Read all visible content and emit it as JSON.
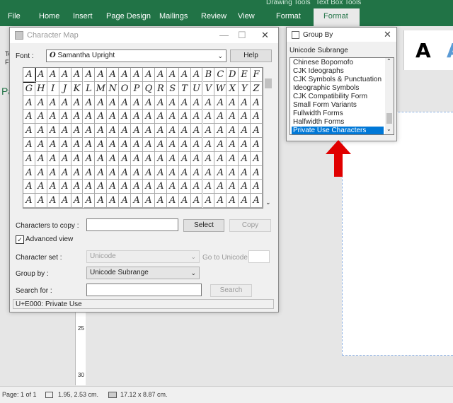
{
  "ribbon": {
    "context_tabs": [
      "Drawing Tools",
      "Text Box Tools"
    ],
    "tabs": [
      "File",
      "Home",
      "Insert",
      "Page Design",
      "Mailings",
      "Review",
      "View",
      "Format"
    ],
    "selected_tab": "Format",
    "colors": {
      "ribbon": "#217346",
      "selected": "#0078d7",
      "arrow": "#e00000"
    }
  },
  "left_fragments": {
    "te": "Te",
    "fi": "Fi",
    "pa": "Pa"
  },
  "preview_letters": {
    "a1": "A",
    "a2": "A"
  },
  "ruler": {
    "marks": [
      "25",
      "30"
    ]
  },
  "status_bar": {
    "page": "Page: 1 of 1",
    "position": "1.95, 2.53 cm.",
    "size": "17.12 x  8.87 cm."
  },
  "charmap": {
    "title": "Character Map",
    "font_label": "Font :",
    "font_value": "Samantha Upright",
    "font_icon": "O",
    "help_button": "Help",
    "grid_row1": [
      "A",
      "A",
      "A",
      "A",
      "A",
      "A",
      "A",
      "A",
      "A",
      "A",
      "A",
      "A",
      "A",
      "A",
      "A",
      "B",
      "C",
      "D",
      "E",
      "F"
    ],
    "grid_row2": [
      "G",
      "H",
      "I",
      "J",
      "K",
      "L",
      "M",
      "N",
      "O",
      "P",
      "Q",
      "R",
      "S",
      "T",
      "U",
      "V",
      "W",
      "X",
      "Y",
      "Z"
    ],
    "grid_fill": "A",
    "copy_label": "Characters to copy :",
    "select_button": "Select",
    "copy_button": "Copy",
    "advanced_view": "Advanced view",
    "charset_label": "Character set :",
    "charset_value": "Unicode",
    "goto_label": "Go to Unicode :",
    "groupby_label": "Group by :",
    "groupby_value": "Unicode Subrange",
    "search_label": "Search for :",
    "search_button": "Search",
    "status": "U+E000: Private Use"
  },
  "groupby": {
    "title": "Group By",
    "subtitle": "Unicode Subrange",
    "items": [
      "Chinese Bopomofo",
      "CJK Ideographs",
      "CJK Symbols & Punctuation",
      "Ideographic Symbols",
      "CJK Compatibility Form",
      "Small Form Variants",
      "Fullwidth Forms",
      "Halfwidth Forms",
      "Private Use Characters"
    ],
    "selected": "Private Use Characters"
  }
}
